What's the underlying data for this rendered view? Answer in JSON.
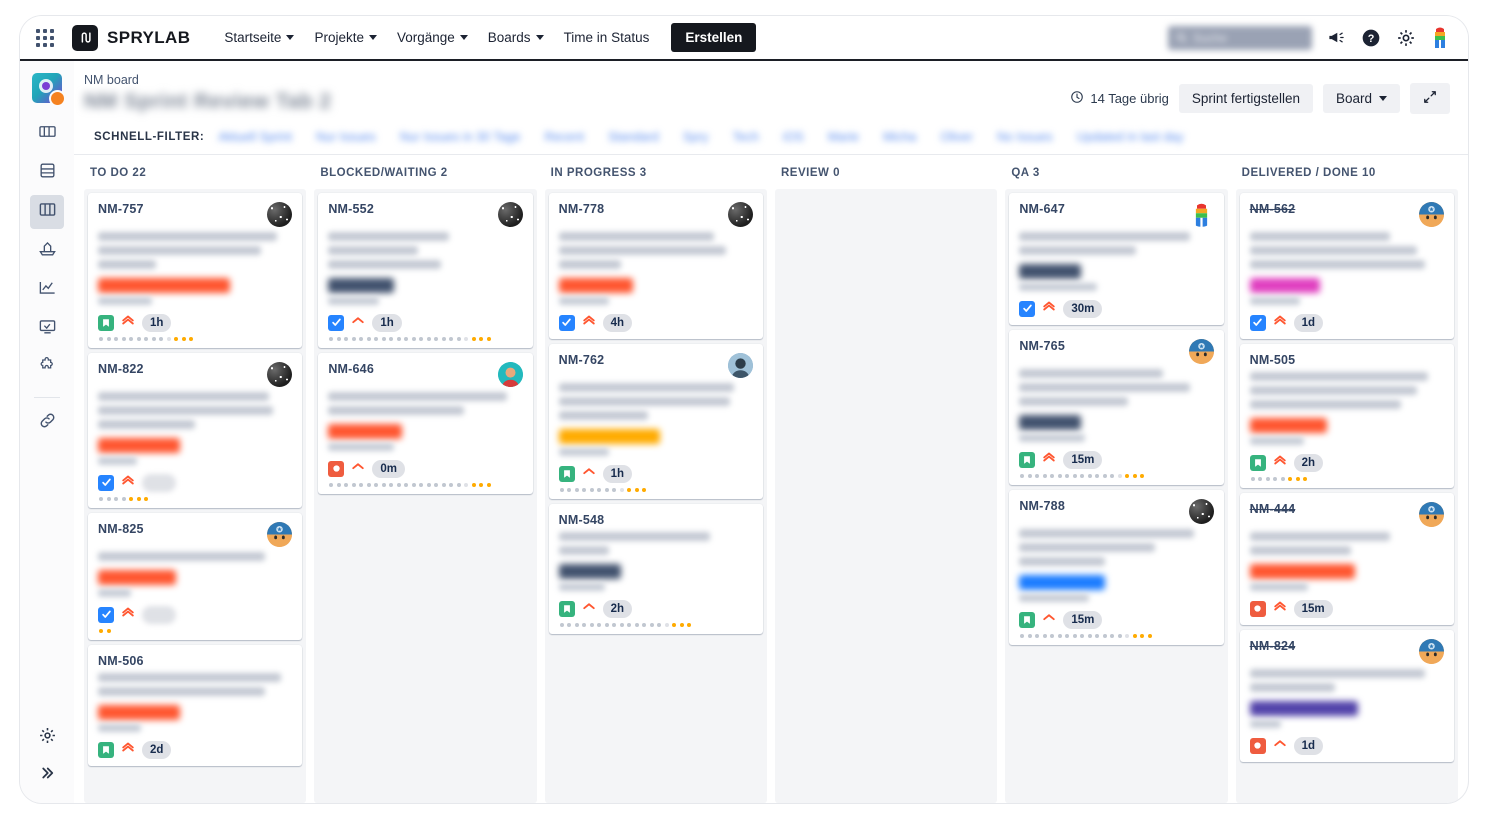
{
  "topnav": {
    "apps_icon": "grid-apps-icon",
    "logo_text": "SPRYLAB",
    "items": [
      {
        "label": "Startseite",
        "has_caret": true
      },
      {
        "label": "Projekte",
        "has_caret": true
      },
      {
        "label": "Vorgänge",
        "has_caret": true
      },
      {
        "label": "Boards",
        "has_caret": true
      },
      {
        "label": "Time in Status",
        "has_caret": false
      }
    ],
    "create_label": "Erstellen",
    "search_placeholder": "Suche",
    "icons": [
      "megaphone-icon",
      "help-icon",
      "gear-icon",
      "profile-avatar-icon"
    ]
  },
  "rail": {
    "project_avatar": "project-avatar",
    "items": [
      {
        "name": "roadmap-icon"
      },
      {
        "name": "backlog-icon"
      },
      {
        "name": "board-icon",
        "active": true
      },
      {
        "name": "releases-icon"
      },
      {
        "name": "reports-icon"
      },
      {
        "name": "deployments-icon"
      },
      {
        "name": "addons-icon"
      }
    ],
    "link_icon": "link-icon",
    "bottom": [
      {
        "name": "project-settings-icon"
      },
      {
        "name": "expand-sidebar-icon"
      }
    ]
  },
  "board": {
    "breadcrumb": "NM board",
    "sprint_title": "NM Sprint Review Tab 2",
    "days_left": "14 Tage übrig",
    "clock_icon": "clock-icon",
    "complete_sprint_label": "Sprint fertigstellen",
    "view_select_label": "Board",
    "fullscreen_icon": "fullscreen-icon",
    "quick_filter_label": "SCHNELL-FILTER:",
    "quick_filters": [
      {
        "label": "Aktuell Sprint"
      },
      {
        "label": "Nur Issues"
      },
      {
        "label": "Nur Issues in 30 Tage"
      },
      {
        "label": "Recent"
      },
      {
        "label": "Standard"
      },
      {
        "label": "Spry"
      },
      {
        "label": "Tech"
      },
      {
        "label": "iOS"
      },
      {
        "label": "Marie"
      },
      {
        "label": "Micha"
      },
      {
        "label": "Oliver"
      },
      {
        "label": "No Issues"
      },
      {
        "label": "Updated in last day"
      }
    ]
  },
  "columns": [
    {
      "name": "todo",
      "title": "TO DO",
      "count": "22",
      "cards": [
        {
          "key": "NM-757",
          "done": false,
          "avatar": "a-dark",
          "title_lines": [
            92,
            84,
            30
          ],
          "label_color": "#ff5630",
          "label_width": 68,
          "sub_width": 28,
          "type": "story",
          "priority": "highest",
          "estimate": "1h",
          "dots": 13,
          "dot_active": 9
        },
        {
          "key": "NM-822",
          "done": false,
          "avatar": "a-dark",
          "title_lines": [
            88,
            90,
            50
          ],
          "label_color": "#ff5630",
          "label_width": 42,
          "sub_width": 20,
          "type": "task",
          "priority": "highest",
          "estimate": "",
          "dots": 7,
          "dot_active": 4
        },
        {
          "key": "NM-825",
          "done": false,
          "avatar": "a-cap",
          "title_lines": [
            86
          ],
          "label_color": "#ff5630",
          "label_width": 40,
          "sub_width": 17,
          "type": "task",
          "priority": "highest",
          "estimate": "",
          "dots": 2,
          "dot_active": 0
        },
        {
          "key": "NM-506",
          "done": false,
          "avatar": "",
          "title_lines": [
            94,
            86
          ],
          "label_color": "#ff5630",
          "label_width": 42,
          "sub_width": 22,
          "type": "story",
          "priority": "highest",
          "estimate": "2d",
          "dots": 0,
          "dot_active": 0
        }
      ]
    },
    {
      "name": "blocked",
      "title": "BLOCKED/WAITING",
      "count": "2",
      "cards": [
        {
          "key": "NM-552",
          "done": false,
          "avatar": "a-dark",
          "title_lines": [
            62,
            46,
            58
          ],
          "label_color": "#42526e",
          "label_width": 34,
          "sub_width": 26,
          "type": "task",
          "priority": "medium",
          "estimate": "1h",
          "dots": 22,
          "dot_active": 18
        },
        {
          "key": "NM-646",
          "done": false,
          "avatar": "a-teal",
          "title_lines": [
            92,
            70
          ],
          "label_color": "#ff5630",
          "label_width": 38,
          "sub_width": 34,
          "type": "bug",
          "priority": "medium",
          "estimate": "0m",
          "dots": 22,
          "dot_active": 18
        }
      ]
    },
    {
      "name": "inprogress",
      "title": "IN PROGRESS",
      "count": "3",
      "cards": [
        {
          "key": "NM-778",
          "done": false,
          "avatar": "a-dark",
          "title_lines": [
            80,
            86,
            32
          ],
          "label_color": "#ff5630",
          "label_width": 38,
          "sub_width": 26,
          "type": "task",
          "priority": "highest",
          "estimate": "4h",
          "dots": 0,
          "dot_active": 0
        },
        {
          "key": "NM-762",
          "done": false,
          "avatar": "a-blue",
          "title_lines": [
            90,
            88,
            46
          ],
          "label_color": "#ffab00",
          "label_width": 52,
          "sub_width": 26,
          "type": "story",
          "priority": "medium",
          "estimate": "1h",
          "dots": 12,
          "dot_active": 8
        },
        {
          "key": "NM-548",
          "done": false,
          "avatar": "",
          "title_lines": [
            78,
            26
          ],
          "label_color": "#42526e",
          "label_width": 32,
          "sub_width": 24,
          "type": "story",
          "priority": "medium",
          "estimate": "2h",
          "dots": 18,
          "dot_active": 14
        }
      ]
    },
    {
      "name": "review",
      "title": "REVIEW",
      "count": "0",
      "cards": []
    },
    {
      "name": "qa",
      "title": "QA",
      "count": "3",
      "cards": [
        {
          "key": "NM-647",
          "done": false,
          "avatar": "a-rainbow",
          "title_lines": [
            88,
            60
          ],
          "label_color": "#42526e",
          "label_width": 32,
          "sub_width": 40,
          "type": "task",
          "priority": "highest",
          "estimate": "30m",
          "dots": 0,
          "dot_active": 0
        },
        {
          "key": "NM-765",
          "done": false,
          "avatar": "a-cap",
          "title_lines": [
            74,
            88,
            56
          ],
          "label_color": "#42526e",
          "label_width": 32,
          "sub_width": 34,
          "type": "story",
          "priority": "highest",
          "estimate": "15m",
          "dots": 17,
          "dot_active": 13
        },
        {
          "key": "NM-788",
          "done": false,
          "avatar": "a-dark",
          "title_lines": [
            90,
            70,
            44
          ],
          "label_color": "#1b7cff",
          "label_width": 44,
          "sub_width": 36,
          "type": "story",
          "priority": "medium",
          "estimate": "15m",
          "dots": 18,
          "dot_active": 14
        }
      ]
    },
    {
      "name": "done",
      "title": "DELIVERED / DONE",
      "count": "10",
      "cards": [
        {
          "key": "NM-562",
          "done": true,
          "avatar": "a-cap",
          "title_lines": [
            72,
            86,
            90
          ],
          "label_color": "#e040c0",
          "label_width": 36,
          "sub_width": 26,
          "type": "task",
          "priority": "highest",
          "estimate": "1d",
          "dots": 0,
          "dot_active": 0
        },
        {
          "key": "NM-505",
          "done": false,
          "avatar": "",
          "title_lines": [
            92,
            86,
            78
          ],
          "label_color": "#ff5630",
          "label_width": 40,
          "sub_width": 28,
          "type": "story",
          "priority": "highest",
          "estimate": "2h",
          "dots": 8,
          "dot_active": 5
        },
        {
          "key": "NM-444",
          "done": true,
          "avatar": "a-cap",
          "title_lines": [
            72,
            52
          ],
          "label_color": "#ff5630",
          "label_width": 54,
          "sub_width": 30,
          "type": "bug",
          "priority": "highest",
          "estimate": "15m",
          "dots": 0,
          "dot_active": 0
        },
        {
          "key": "NM-824",
          "done": true,
          "avatar": "a-cap",
          "title_lines": [
            90,
            44
          ],
          "label_color": "#5243aa",
          "label_width": 56,
          "sub_width": 16,
          "type": "bug",
          "priority": "medium",
          "estimate": "1d",
          "dots": 0,
          "dot_active": 0
        }
      ]
    }
  ]
}
